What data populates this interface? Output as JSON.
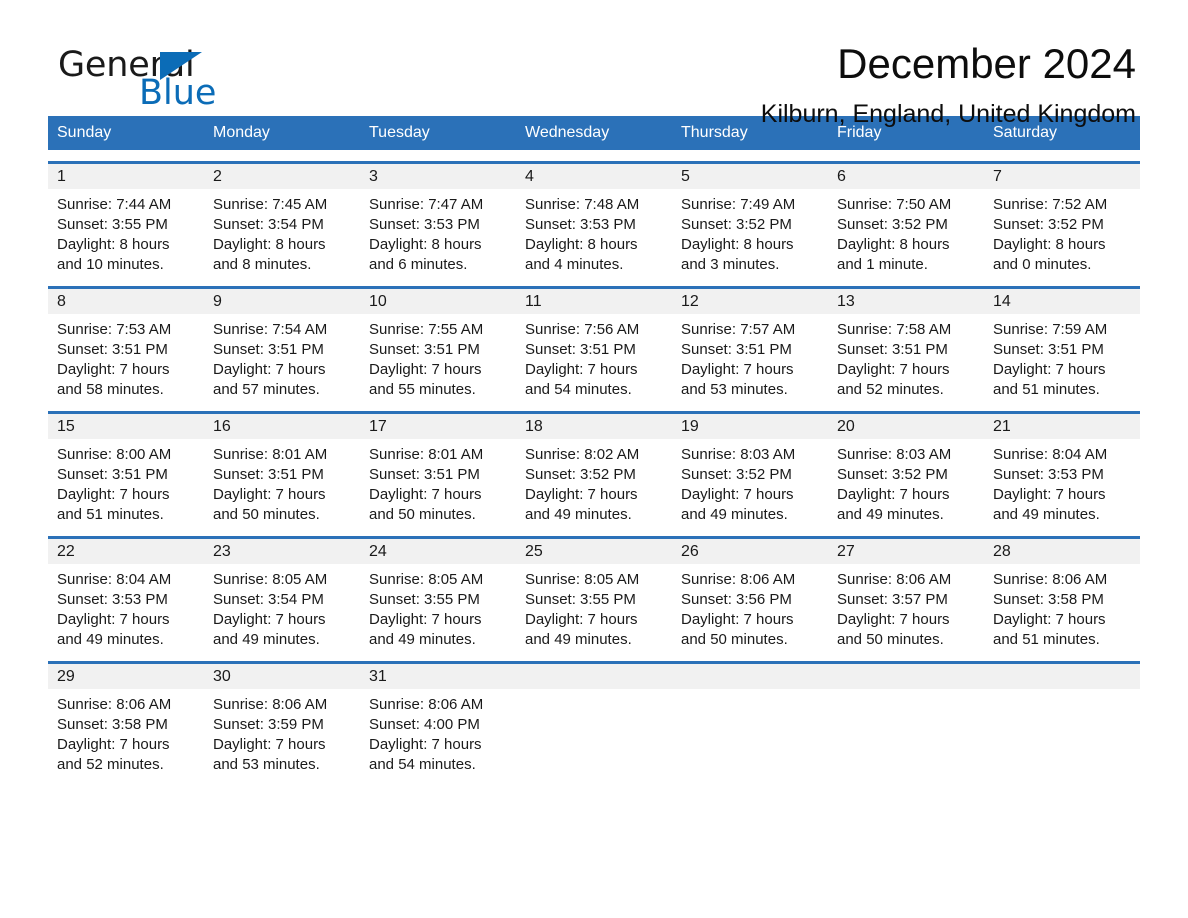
{
  "brand": {
    "name_part1": "General",
    "name_part2": "Blue",
    "triangle_color": "#0b6cb7"
  },
  "header": {
    "title": "December 2024",
    "location": "Kilburn, England, United Kingdom",
    "accent_color": "#2b71b8",
    "band_color": "#f1f1f1"
  },
  "weekdays": [
    "Sunday",
    "Monday",
    "Tuesday",
    "Wednesday",
    "Thursday",
    "Friday",
    "Saturday"
  ],
  "weeks": [
    [
      {
        "day": "1",
        "sunrise": "Sunrise: 7:44 AM",
        "sunset": "Sunset: 3:55 PM",
        "daylight1": "Daylight: 8 hours",
        "daylight2": "and 10 minutes."
      },
      {
        "day": "2",
        "sunrise": "Sunrise: 7:45 AM",
        "sunset": "Sunset: 3:54 PM",
        "daylight1": "Daylight: 8 hours",
        "daylight2": "and 8 minutes."
      },
      {
        "day": "3",
        "sunrise": "Sunrise: 7:47 AM",
        "sunset": "Sunset: 3:53 PM",
        "daylight1": "Daylight: 8 hours",
        "daylight2": "and 6 minutes."
      },
      {
        "day": "4",
        "sunrise": "Sunrise: 7:48 AM",
        "sunset": "Sunset: 3:53 PM",
        "daylight1": "Daylight: 8 hours",
        "daylight2": "and 4 minutes."
      },
      {
        "day": "5",
        "sunrise": "Sunrise: 7:49 AM",
        "sunset": "Sunset: 3:52 PM",
        "daylight1": "Daylight: 8 hours",
        "daylight2": "and 3 minutes."
      },
      {
        "day": "6",
        "sunrise": "Sunrise: 7:50 AM",
        "sunset": "Sunset: 3:52 PM",
        "daylight1": "Daylight: 8 hours",
        "daylight2": "and 1 minute."
      },
      {
        "day": "7",
        "sunrise": "Sunrise: 7:52 AM",
        "sunset": "Sunset: 3:52 PM",
        "daylight1": "Daylight: 8 hours",
        "daylight2": "and 0 minutes."
      }
    ],
    [
      {
        "day": "8",
        "sunrise": "Sunrise: 7:53 AM",
        "sunset": "Sunset: 3:51 PM",
        "daylight1": "Daylight: 7 hours",
        "daylight2": "and 58 minutes."
      },
      {
        "day": "9",
        "sunrise": "Sunrise: 7:54 AM",
        "sunset": "Sunset: 3:51 PM",
        "daylight1": "Daylight: 7 hours",
        "daylight2": "and 57 minutes."
      },
      {
        "day": "10",
        "sunrise": "Sunrise: 7:55 AM",
        "sunset": "Sunset: 3:51 PM",
        "daylight1": "Daylight: 7 hours",
        "daylight2": "and 55 minutes."
      },
      {
        "day": "11",
        "sunrise": "Sunrise: 7:56 AM",
        "sunset": "Sunset: 3:51 PM",
        "daylight1": "Daylight: 7 hours",
        "daylight2": "and 54 minutes."
      },
      {
        "day": "12",
        "sunrise": "Sunrise: 7:57 AM",
        "sunset": "Sunset: 3:51 PM",
        "daylight1": "Daylight: 7 hours",
        "daylight2": "and 53 minutes."
      },
      {
        "day": "13",
        "sunrise": "Sunrise: 7:58 AM",
        "sunset": "Sunset: 3:51 PM",
        "daylight1": "Daylight: 7 hours",
        "daylight2": "and 52 minutes."
      },
      {
        "day": "14",
        "sunrise": "Sunrise: 7:59 AM",
        "sunset": "Sunset: 3:51 PM",
        "daylight1": "Daylight: 7 hours",
        "daylight2": "and 51 minutes."
      }
    ],
    [
      {
        "day": "15",
        "sunrise": "Sunrise: 8:00 AM",
        "sunset": "Sunset: 3:51 PM",
        "daylight1": "Daylight: 7 hours",
        "daylight2": "and 51 minutes."
      },
      {
        "day": "16",
        "sunrise": "Sunrise: 8:01 AM",
        "sunset": "Sunset: 3:51 PM",
        "daylight1": "Daylight: 7 hours",
        "daylight2": "and 50 minutes."
      },
      {
        "day": "17",
        "sunrise": "Sunrise: 8:01 AM",
        "sunset": "Sunset: 3:51 PM",
        "daylight1": "Daylight: 7 hours",
        "daylight2": "and 50 minutes."
      },
      {
        "day": "18",
        "sunrise": "Sunrise: 8:02 AM",
        "sunset": "Sunset: 3:52 PM",
        "daylight1": "Daylight: 7 hours",
        "daylight2": "and 49 minutes."
      },
      {
        "day": "19",
        "sunrise": "Sunrise: 8:03 AM",
        "sunset": "Sunset: 3:52 PM",
        "daylight1": "Daylight: 7 hours",
        "daylight2": "and 49 minutes."
      },
      {
        "day": "20",
        "sunrise": "Sunrise: 8:03 AM",
        "sunset": "Sunset: 3:52 PM",
        "daylight1": "Daylight: 7 hours",
        "daylight2": "and 49 minutes."
      },
      {
        "day": "21",
        "sunrise": "Sunrise: 8:04 AM",
        "sunset": "Sunset: 3:53 PM",
        "daylight1": "Daylight: 7 hours",
        "daylight2": "and 49 minutes."
      }
    ],
    [
      {
        "day": "22",
        "sunrise": "Sunrise: 8:04 AM",
        "sunset": "Sunset: 3:53 PM",
        "daylight1": "Daylight: 7 hours",
        "daylight2": "and 49 minutes."
      },
      {
        "day": "23",
        "sunrise": "Sunrise: 8:05 AM",
        "sunset": "Sunset: 3:54 PM",
        "daylight1": "Daylight: 7 hours",
        "daylight2": "and 49 minutes."
      },
      {
        "day": "24",
        "sunrise": "Sunrise: 8:05 AM",
        "sunset": "Sunset: 3:55 PM",
        "daylight1": "Daylight: 7 hours",
        "daylight2": "and 49 minutes."
      },
      {
        "day": "25",
        "sunrise": "Sunrise: 8:05 AM",
        "sunset": "Sunset: 3:55 PM",
        "daylight1": "Daylight: 7 hours",
        "daylight2": "and 49 minutes."
      },
      {
        "day": "26",
        "sunrise": "Sunrise: 8:06 AM",
        "sunset": "Sunset: 3:56 PM",
        "daylight1": "Daylight: 7 hours",
        "daylight2": "and 50 minutes."
      },
      {
        "day": "27",
        "sunrise": "Sunrise: 8:06 AM",
        "sunset": "Sunset: 3:57 PM",
        "daylight1": "Daylight: 7 hours",
        "daylight2": "and 50 minutes."
      },
      {
        "day": "28",
        "sunrise": "Sunrise: 8:06 AM",
        "sunset": "Sunset: 3:58 PM",
        "daylight1": "Daylight: 7 hours",
        "daylight2": "and 51 minutes."
      }
    ],
    [
      {
        "day": "29",
        "sunrise": "Sunrise: 8:06 AM",
        "sunset": "Sunset: 3:58 PM",
        "daylight1": "Daylight: 7 hours",
        "daylight2": "and 52 minutes."
      },
      {
        "day": "30",
        "sunrise": "Sunrise: 8:06 AM",
        "sunset": "Sunset: 3:59 PM",
        "daylight1": "Daylight: 7 hours",
        "daylight2": "and 53 minutes."
      },
      {
        "day": "31",
        "sunrise": "Sunrise: 8:06 AM",
        "sunset": "Sunset: 4:00 PM",
        "daylight1": "Daylight: 7 hours",
        "daylight2": "and 54 minutes."
      },
      {
        "day": "",
        "sunrise": "",
        "sunset": "",
        "daylight1": "",
        "daylight2": ""
      },
      {
        "day": "",
        "sunrise": "",
        "sunset": "",
        "daylight1": "",
        "daylight2": ""
      },
      {
        "day": "",
        "sunrise": "",
        "sunset": "",
        "daylight1": "",
        "daylight2": ""
      },
      {
        "day": "",
        "sunrise": "",
        "sunset": "",
        "daylight1": "",
        "daylight2": ""
      }
    ]
  ]
}
